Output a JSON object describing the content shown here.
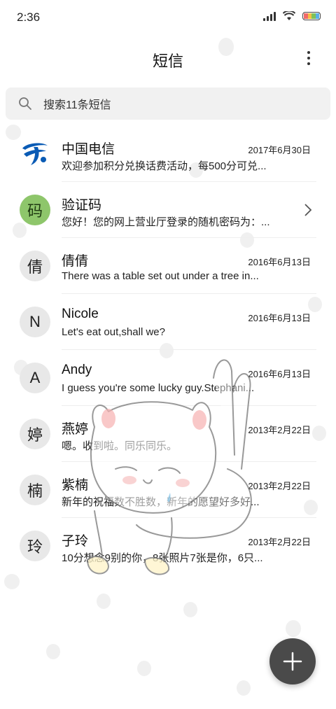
{
  "status_bar": {
    "time": "2:36",
    "icons": [
      "signal-icon",
      "wifi-icon",
      "battery-icon"
    ],
    "battery_colors": [
      "#f06a6a",
      "#f5c043",
      "#7fc15a",
      "#5ab0e8"
    ]
  },
  "header": {
    "title": "短信",
    "menu_icon": "more-vertical-icon"
  },
  "search": {
    "placeholder": "搜索11条短信",
    "icon": "search-icon"
  },
  "messages": [
    {
      "avatar": "",
      "avatar_type": "logo",
      "avatar_icon": "china-telecom-logo",
      "sender": "中国电信",
      "date": "2017年6月30日",
      "preview": "欢迎参加积分兑换话费活动，每500分可兑..."
    },
    {
      "avatar": "码",
      "avatar_type": "green",
      "sender": "验证码",
      "date": "",
      "preview": "您好！您的网上营业厅登录的随机密码为：...",
      "chevron_icon": "chevron-right-icon"
    },
    {
      "avatar": "倩",
      "avatar_type": "default",
      "sender": "倩倩",
      "date": "2016年6月13日",
      "preview": "There was a table set out under a tree in..."
    },
    {
      "avatar": "N",
      "avatar_type": "default",
      "sender": "Nicole",
      "date": "2016年6月13日",
      "preview": "Let's eat out,shall we?"
    },
    {
      "avatar": "A",
      "avatar_type": "default",
      "sender": "Andy",
      "date": "2016年6月13日",
      "preview": "I guess you're some lucky guy.Stephani..."
    },
    {
      "avatar": "婷",
      "avatar_type": "default",
      "sender": "燕婷",
      "date": "2013年2月22日",
      "preview": "嗯。收到啦。同乐同乐。"
    },
    {
      "avatar": "楠",
      "avatar_type": "default",
      "sender": "紫楠",
      "date": "2013年2月22日",
      "preview": "新年的祝福数不胜数，新年的愿望好多好..."
    },
    {
      "avatar": "玲",
      "avatar_type": "default",
      "sender": "子玲",
      "date": "2013年2月22日",
      "preview": "10分想念9别的你，8张照片7张是你，6只..."
    }
  ],
  "fab": {
    "icon": "plus-icon"
  },
  "colors": {
    "accent_fab": "#4a4a4a",
    "verify_avatar": "#8ec66b",
    "telecom_blue": "#0a5bb5"
  }
}
